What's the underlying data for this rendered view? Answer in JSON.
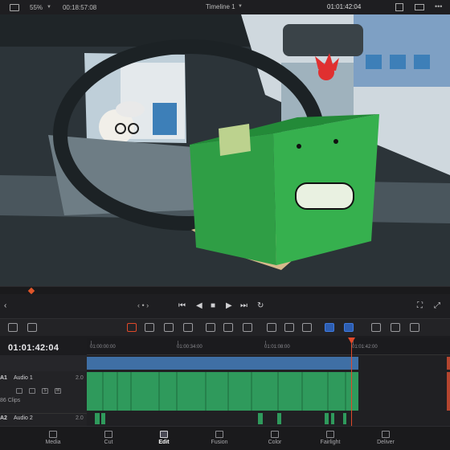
{
  "viewer_bar": {
    "zoom": "55%",
    "source_timecode": "00:18:57:08",
    "timeline_name": "Timeline 1",
    "record_timecode": "01:01:42:04"
  },
  "timeline": {
    "current_timecode": "01:01:42:04",
    "ruler_ticks": [
      "01:00:00:00",
      "01:00:34:00",
      "01:01:08:00",
      "01:01:42:00"
    ],
    "tracks": [
      {
        "id": "A1",
        "name": "Audio 1",
        "volume": "2.0",
        "clips_label": "86 Clips"
      },
      {
        "id": "A2",
        "name": "Audio 2",
        "volume": "2.0"
      }
    ]
  },
  "pages": [
    {
      "label": "Media",
      "icon": "media-icon"
    },
    {
      "label": "Cut",
      "icon": "cut-icon"
    },
    {
      "label": "Edit",
      "icon": "edit-icon",
      "active": true
    },
    {
      "label": "Fusion",
      "icon": "fusion-icon"
    },
    {
      "label": "Color",
      "icon": "color-icon"
    },
    {
      "label": "Fairlight",
      "icon": "fairlight-icon"
    },
    {
      "label": "Deliver",
      "icon": "deliver-icon"
    }
  ],
  "colors": {
    "accent_active": "#e0492a",
    "video_clip": "#3f6fa5",
    "audio_clip": "#2f9a5c",
    "flag_blue": "#3f7be0"
  }
}
